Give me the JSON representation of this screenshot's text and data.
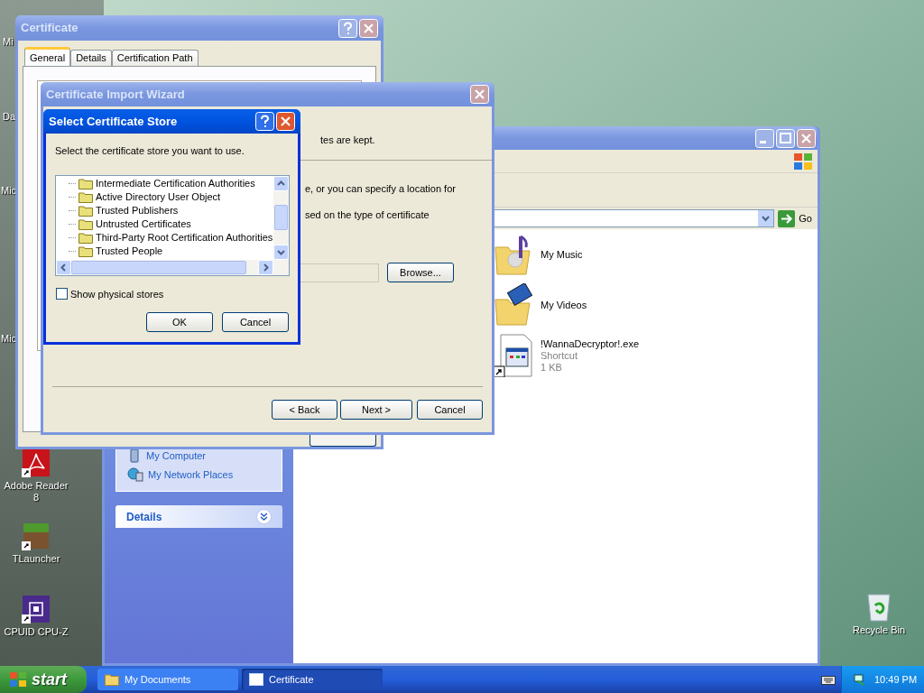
{
  "desktop": {
    "cut_off_labels": [
      "Mi",
      "Da",
      "Mic",
      "Mic"
    ],
    "icons": [
      {
        "label": "Adobe Reader 8",
        "kind": "pdf"
      },
      {
        "label": "TLauncher",
        "kind": "grass-block"
      },
      {
        "label": "CPUID CPU-Z",
        "kind": "chip"
      },
      {
        "label": "Recycle Bin",
        "kind": "recycle"
      }
    ]
  },
  "explorer": {
    "active": false,
    "go_label": "Go",
    "tasks": [
      {
        "label": "My Computer",
        "kind": "computer"
      },
      {
        "label": "My Network Places",
        "kind": "network"
      }
    ],
    "details_title": "Details",
    "items": [
      {
        "name": "My Music",
        "kind": "music-folder"
      },
      {
        "name": "My Videos",
        "kind": "video-folder"
      },
      {
        "name": "!WannaDecryptor!.exe",
        "kind": "shortcut",
        "type": "Shortcut",
        "size": "1 KB"
      }
    ]
  },
  "certificate_window": {
    "title": "Certificate",
    "active": false,
    "tabs": [
      {
        "label": "General",
        "selected": true
      },
      {
        "label": "Details",
        "selected": false
      },
      {
        "label": "Certification Path",
        "selected": false
      }
    ]
  },
  "import_wizard": {
    "title": "Certificate Import Wizard",
    "active": false,
    "header_text": "tes are kept.",
    "body_lines": [
      "e, or you can specify a location for",
      "sed on the type of certificate"
    ],
    "browse_label": "Browse...",
    "buttons": [
      "< Back",
      "Next >",
      "Cancel"
    ]
  },
  "store_dialog": {
    "title": "Select Certificate Store",
    "active": true,
    "prompt": "Select the certificate store you want to use.",
    "stores": [
      "Intermediate Certification Authorities",
      "Active Directory User Object",
      "Trusted Publishers",
      "Untrusted Certificates",
      "Third-Party Root Certification Authorities",
      "Trusted People"
    ],
    "show_physical_stores": {
      "label": "Show physical stores",
      "checked": false
    },
    "buttons": [
      "OK",
      "Cancel"
    ]
  },
  "taskbar": {
    "start_label": "start",
    "tasks": [
      {
        "label": "My Documents",
        "kind": "folder",
        "selected": false
      },
      {
        "label": "Certificate",
        "kind": "window",
        "selected": true
      }
    ],
    "clock": "10:49 PM"
  }
}
